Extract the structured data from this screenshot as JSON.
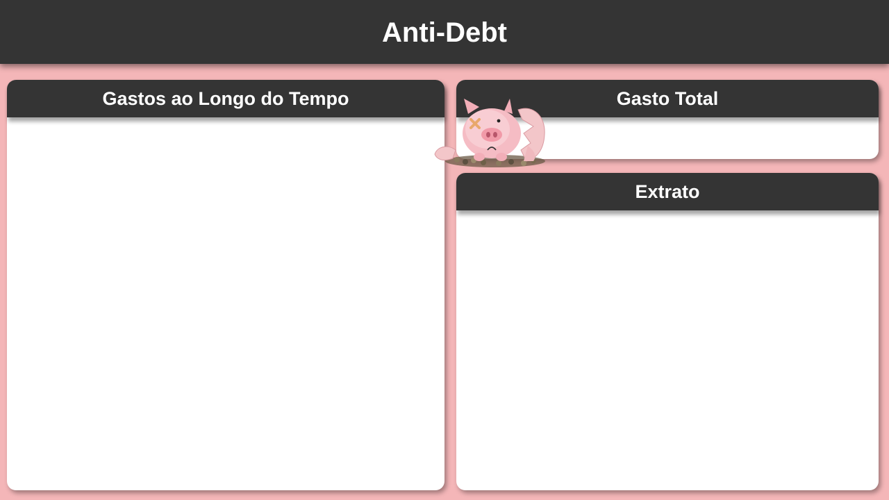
{
  "app": {
    "title": "Anti-Debt"
  },
  "panels": {
    "gastos": {
      "title": "Gastos ao Longo do Tempo"
    },
    "total": {
      "title": "Gasto Total"
    },
    "extrato": {
      "title": "Extrato"
    }
  },
  "colors": {
    "background": "#f4b6b8",
    "header": "#343434",
    "panel": "#ffffff",
    "text_light": "#ffffff"
  },
  "icons": {
    "mascot": "broken-piggy-bank-icon"
  }
}
